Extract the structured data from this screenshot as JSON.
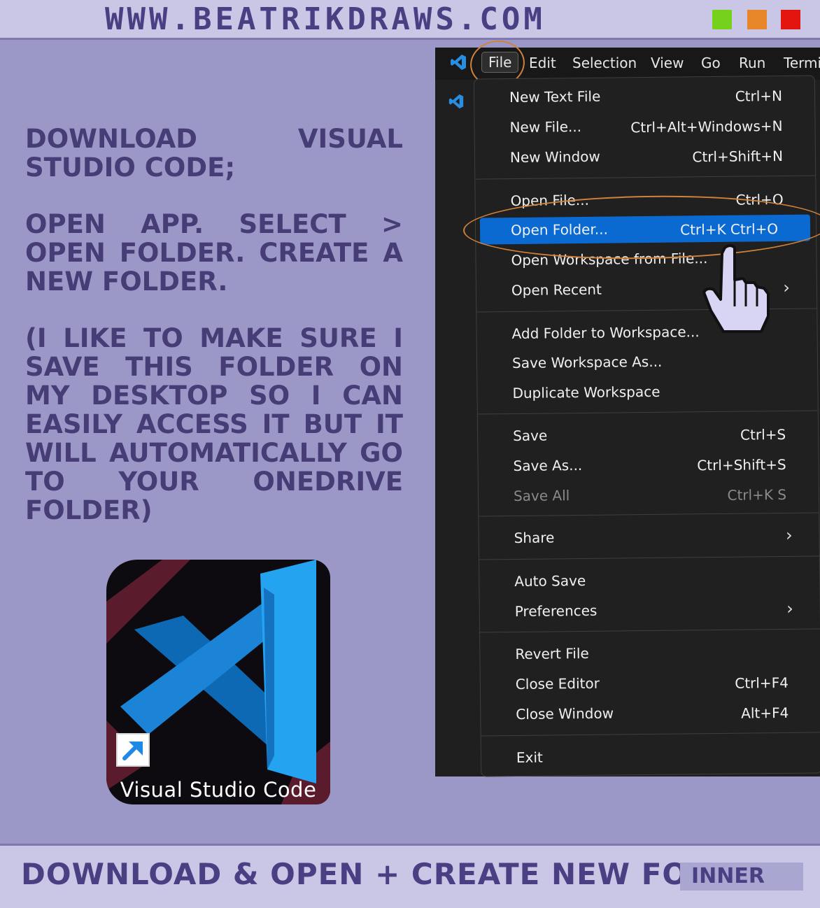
{
  "header": {
    "site_url": "www.beatrikdraws.com",
    "window_buttons": [
      {
        "name": "green",
        "color": "#76d11c"
      },
      {
        "name": "orange",
        "color": "#e8872a"
      },
      {
        "name": "red",
        "color": "#e3150f"
      }
    ]
  },
  "instructions": {
    "step1": "Download visual studio code;",
    "step2": "Open app. Select > open folder. Create a new folder.",
    "note": "(I like to make sure I save this folder on my desktop so I can easily access it but it will automatically go to your onedrive folder)"
  },
  "desktop_shortcut": {
    "icon": "vscode-logo-icon",
    "badge_icon": "shortcut-arrow-icon",
    "label": "Visual Studio Code"
  },
  "menubar": {
    "items": [
      "File",
      "Edit",
      "Selection",
      "View",
      "Go",
      "Run",
      "Termi"
    ]
  },
  "file_menu": {
    "groups": [
      [
        {
          "label": "New Text File",
          "shortcut": "Ctrl+N"
        },
        {
          "label": "New File...",
          "shortcut": "Ctrl+Alt+Windows+N"
        },
        {
          "label": "New Window",
          "shortcut": "Ctrl+Shift+N"
        }
      ],
      [
        {
          "label": "Open File...",
          "shortcut": "Ctrl+O"
        },
        {
          "label": "Open Folder...",
          "shortcut": "Ctrl+K Ctrl+O",
          "selected": true
        },
        {
          "label": "Open Workspace from File...",
          "shortcut": ""
        },
        {
          "label": "Open Recent",
          "shortcut": "",
          "submenu": true
        }
      ],
      [
        {
          "label": "Add Folder to Workspace...",
          "shortcut": ""
        },
        {
          "label": "Save Workspace As...",
          "shortcut": ""
        },
        {
          "label": "Duplicate Workspace",
          "shortcut": ""
        }
      ],
      [
        {
          "label": "Save",
          "shortcut": "Ctrl+S"
        },
        {
          "label": "Save As...",
          "shortcut": "Ctrl+Shift+S"
        },
        {
          "label": "Save All",
          "shortcut": "Ctrl+K S",
          "disabled": true
        }
      ],
      [
        {
          "label": "Share",
          "shortcut": "",
          "submenu": true
        }
      ],
      [
        {
          "label": "Auto Save",
          "shortcut": ""
        },
        {
          "label": "Preferences",
          "shortcut": "",
          "submenu": true
        }
      ],
      [
        {
          "label": "Revert File",
          "shortcut": ""
        },
        {
          "label": "Close Editor",
          "shortcut": "Ctrl+F4"
        },
        {
          "label": "Close Window",
          "shortcut": "Alt+F4"
        }
      ],
      [
        {
          "label": "Exit",
          "shortcut": ""
        }
      ]
    ]
  },
  "footer": {
    "caption": "Download & open + create new folder.",
    "tag": "INNER"
  },
  "colors": {
    "background": "#9b98c8",
    "bar": "#c9c6e6",
    "ink": "#463c76",
    "highlight": "#0a6ad1",
    "annotation": "#d0823a"
  }
}
